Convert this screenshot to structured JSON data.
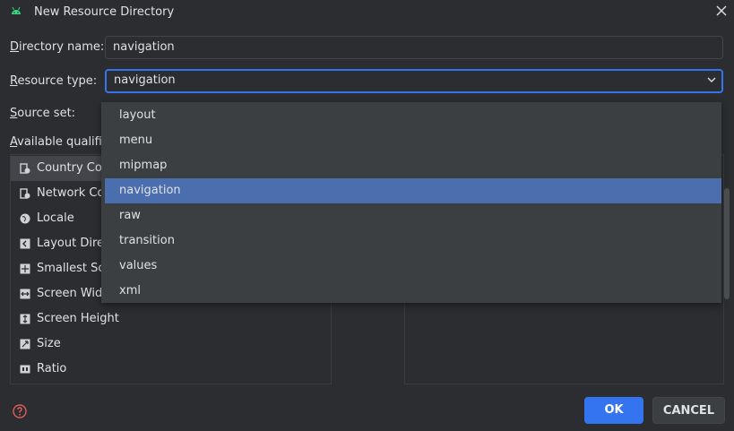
{
  "window": {
    "title": "New Resource Directory"
  },
  "form": {
    "directory_name": {
      "label_first": "D",
      "label_rest": "irectory name:",
      "value": "navigation"
    },
    "resource_type": {
      "label_first": "R",
      "label_rest": "esource type:",
      "value": "navigation"
    },
    "source_set": {
      "label_first": "S",
      "label_rest": "ource set:"
    },
    "available_qualifiers": {
      "label_first": "A",
      "label_rest": "vailable qualifiers"
    }
  },
  "qualifiers": [
    {
      "label": "Country Code",
      "icon": "country-code-icon"
    },
    {
      "label": "Network Code",
      "icon": "network-code-icon"
    },
    {
      "label": "Locale",
      "icon": "globe-icon"
    },
    {
      "label": "Layout Direction",
      "icon": "layout-direction-icon"
    },
    {
      "label": "Smallest Screen Width",
      "icon": "smallest-screen-icon"
    },
    {
      "label": "Screen Width",
      "icon": "screen-width-icon"
    },
    {
      "label": "Screen Height",
      "icon": "screen-height-icon"
    },
    {
      "label": "Size",
      "icon": "size-icon"
    },
    {
      "label": "Ratio",
      "icon": "ratio-icon"
    }
  ],
  "dropdown": {
    "options": [
      "layout",
      "menu",
      "mipmap",
      "navigation",
      "raw",
      "transition",
      "values",
      "xml"
    ],
    "selected": "navigation"
  },
  "buttons": {
    "ok": "OK",
    "cancel": "CANCEL"
  },
  "colors": {
    "accent": "#3574f0",
    "selection": "#4b6eaf",
    "background": "#2b2d30",
    "android_green": "#3ddc84"
  }
}
